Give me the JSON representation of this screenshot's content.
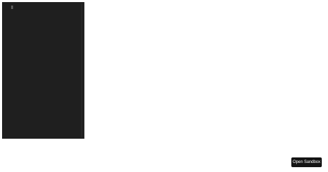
{
  "colors": {
    "page_background": "#ffffff",
    "terminal_background": "#1f1f1f",
    "button_background": "#141414",
    "button_text": "#ffffff"
  },
  "actions": {
    "open_sandbox_label": "Open Sandbox"
  }
}
